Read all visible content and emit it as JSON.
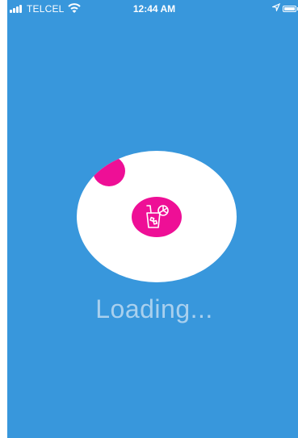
{
  "status_bar": {
    "carrier": "TELCEL",
    "time": "12:44 AM",
    "signal_icon": "signal-bars-icon",
    "wifi_icon": "wifi-icon",
    "location_icon": "location-arrow-icon",
    "battery_icon": "battery-icon"
  },
  "loader": {
    "badge_icon": "drink-cup-icon",
    "text": "Loading..."
  },
  "colors": {
    "background": "#3897dc",
    "accent": "#ee0f96",
    "circle": "#ffffff",
    "loading_text": "#a9d0ee"
  }
}
